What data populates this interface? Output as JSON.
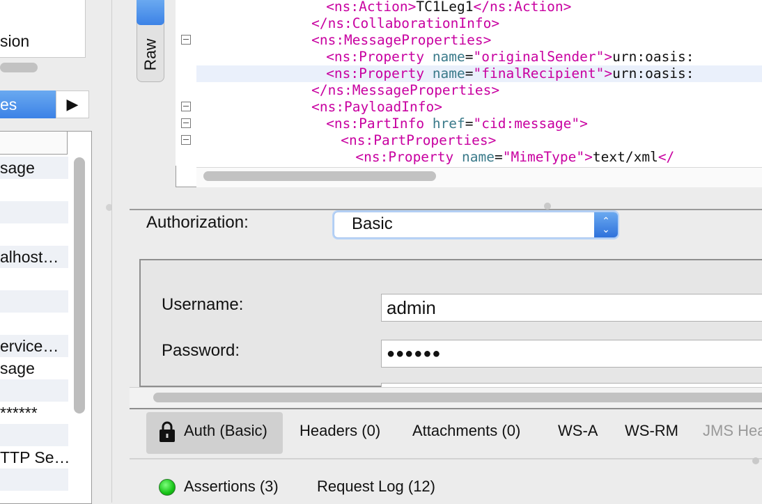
{
  "left_panel": {
    "top_item_text": "sion",
    "properties_tab_label": "es",
    "properties_arrow": "▶",
    "rows": [
      {
        "text": "sage",
        "alt": true
      },
      {
        "text": "",
        "alt": false
      },
      {
        "text": "",
        "alt": true
      },
      {
        "text": "",
        "alt": false
      },
      {
        "text": "alhost…",
        "alt": true
      },
      {
        "text": "",
        "alt": false
      },
      {
        "text": "",
        "alt": true
      },
      {
        "text": "",
        "alt": false
      },
      {
        "text": "ervice…",
        "alt": true
      },
      {
        "text": "sage",
        "alt": false
      },
      {
        "text": "",
        "alt": true
      },
      {
        "text": "******",
        "alt": false
      },
      {
        "text": "",
        "alt": true
      },
      {
        "text": "TTP Se…",
        "alt": false
      },
      {
        "text": "",
        "alt": true
      },
      {
        "text": "",
        "alt": false
      }
    ]
  },
  "editor": {
    "view_tab_label": "Raw",
    "lines": [
      {
        "indent": "    ",
        "parts": [
          [
            "tag",
            "<ns:Action>"
          ],
          [
            "tx",
            "TC1Leg1"
          ],
          [
            "tag",
            "</ns:Action>"
          ]
        ]
      },
      {
        "indent": "  ",
        "parts": [
          [
            "tag",
            "</ns:CollaborationInfo>"
          ]
        ]
      },
      {
        "indent": "  ",
        "parts": [
          [
            "tag",
            "<ns:MessageProperties>"
          ]
        ]
      },
      {
        "indent": "    ",
        "parts": [
          [
            "tag",
            "<ns:Property "
          ],
          [
            "attr",
            "name"
          ],
          [
            "tx",
            "="
          ],
          [
            "val",
            "\"originalSender\""
          ],
          [
            "tag",
            ">"
          ],
          [
            "tx",
            "urn:oasis:"
          ]
        ]
      },
      {
        "indent": "    ",
        "parts": [
          [
            "tag",
            "<ns:Property "
          ],
          [
            "attr",
            "name"
          ],
          [
            "tx",
            "="
          ],
          [
            "val",
            "\"finalRecipient\""
          ],
          [
            "tag",
            ">"
          ],
          [
            "tx",
            "urn:oasis:"
          ]
        ]
      },
      {
        "indent": "  ",
        "parts": [
          [
            "tag",
            "</ns:MessageProperties>"
          ]
        ]
      },
      {
        "indent": "  ",
        "parts": [
          [
            "tag",
            "<ns:PayloadInfo>"
          ]
        ]
      },
      {
        "indent": "    ",
        "parts": [
          [
            "tag",
            "<ns:PartInfo "
          ],
          [
            "attr",
            "href"
          ],
          [
            "tx",
            "="
          ],
          [
            "val",
            "\"cid:message\""
          ],
          [
            "tag",
            ">"
          ]
        ]
      },
      {
        "indent": "      ",
        "parts": [
          [
            "tag",
            "<ns:PartProperties>"
          ]
        ]
      },
      {
        "indent": "        ",
        "parts": [
          [
            "tag",
            "<ns:Property "
          ],
          [
            "attr",
            "name"
          ],
          [
            "tx",
            "="
          ],
          [
            "val",
            "\"MimeType\""
          ],
          [
            "tag",
            ">"
          ],
          [
            "tx",
            "text/xml"
          ],
          [
            "tag",
            "</"
          ]
        ]
      }
    ]
  },
  "auth": {
    "label": "Authorization:",
    "selected": "Basic",
    "username_label": "Username:",
    "username_value": "admin",
    "password_label": "Password:",
    "password_value": "●●●●●●"
  },
  "tabs": {
    "auth": "Auth (Basic)",
    "headers": "Headers (0)",
    "attachments": "Attachments (0)",
    "wsa": "WS-A",
    "wsrm": "WS-RM",
    "jms": "JMS Hea"
  },
  "bottom": {
    "assertions": "Assertions (3)",
    "request_log": "Request Log (12)",
    "status_color": "#17c317"
  },
  "colors": {
    "accent_blue": "#3c82e6",
    "xml_tag": "#c800a0",
    "xml_attr": "#3a7a8a"
  }
}
